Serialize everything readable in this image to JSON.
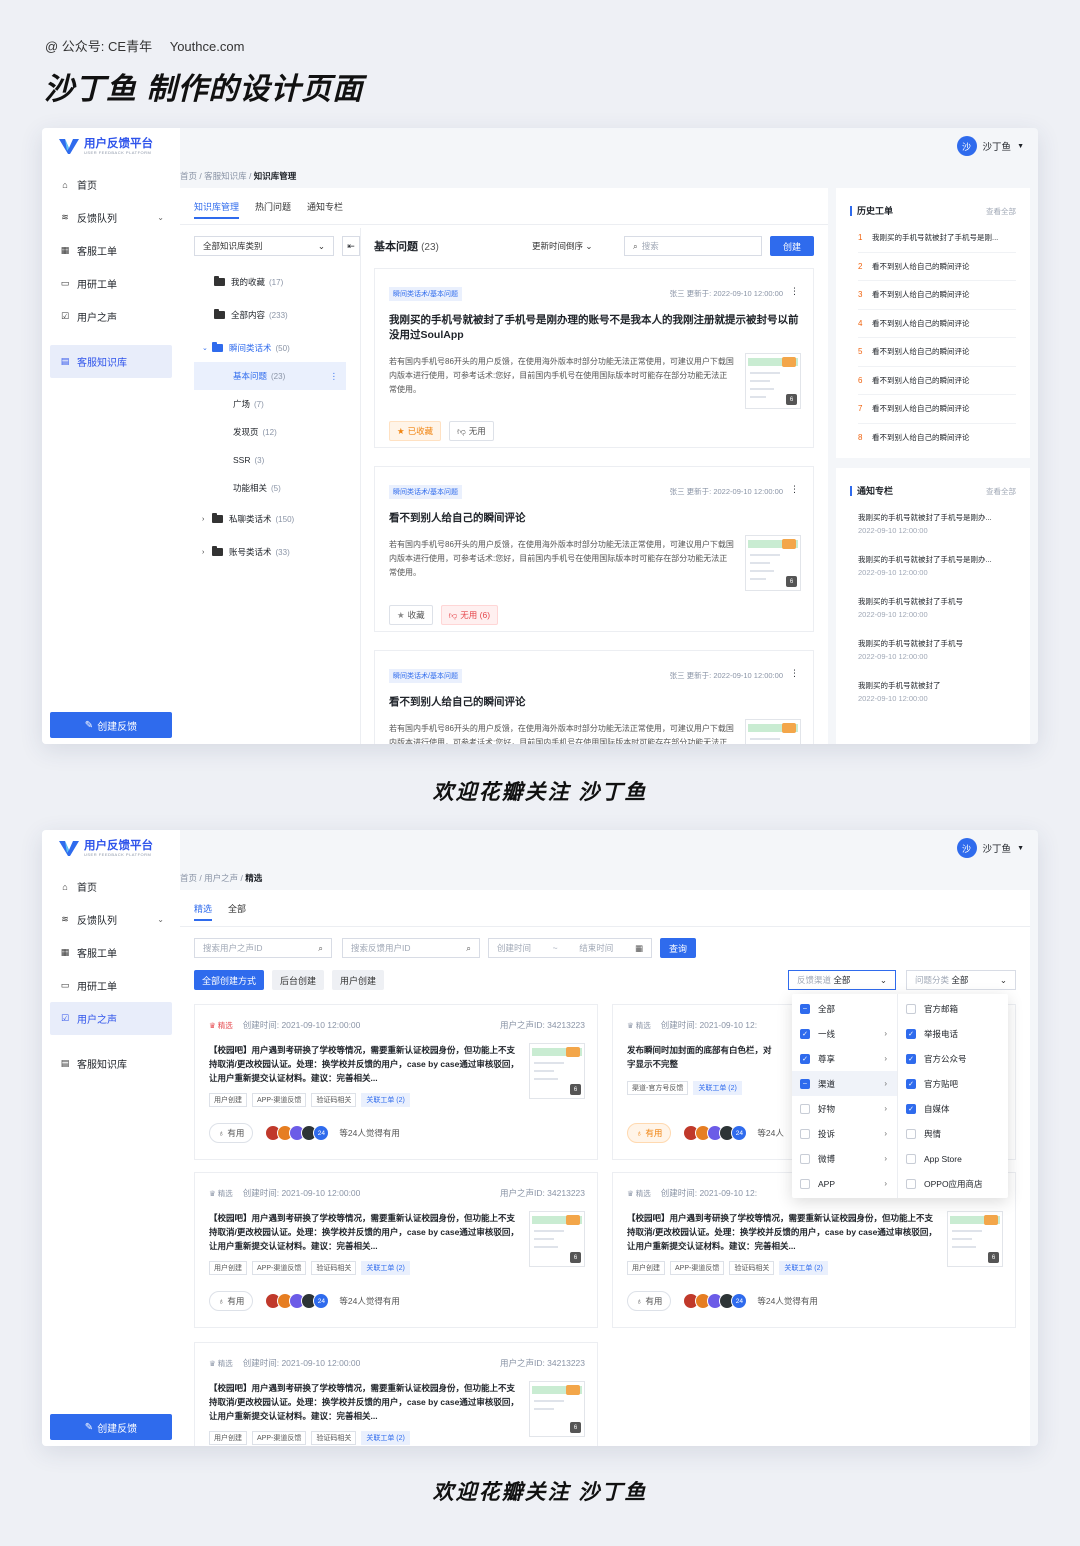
{
  "page": {
    "meta_account": "@ 公众号: CE青年",
    "meta_site": "Youthce.com",
    "heading": "沙丁鱼 制作的设计页面",
    "caption": "欢迎花瓣关注 沙丁鱼"
  },
  "app": {
    "logo_title": "用户反馈平台",
    "logo_sub": "USER FEEDBACK PLATFORM",
    "user_name": "沙丁鱼",
    "user_avatar": "沙",
    "create_button": "创建反馈",
    "nav": [
      {
        "label": "首页",
        "icon": "home-icon"
      },
      {
        "label": "反馈队列",
        "icon": "stack-icon"
      },
      {
        "label": "客服工单",
        "icon": "grid-icon"
      },
      {
        "label": "用研工单",
        "icon": "monitor-icon"
      },
      {
        "label": "用户之声",
        "icon": "chat-icon"
      },
      {
        "label": "客服知识库",
        "icon": "book-icon"
      }
    ]
  },
  "screen1": {
    "breadcrumb": [
      "首页",
      "客服知识库",
      "知识库管理"
    ],
    "tabs": [
      "知识库管理",
      "热门问题",
      "通知专栏"
    ],
    "category_select": "全部知识库类别",
    "tree": [
      {
        "label": "我的收藏",
        "count": "(17)"
      },
      {
        "label": "全部内容",
        "count": "(233)"
      },
      {
        "label": "瞬间类话术",
        "count": "(50)"
      },
      {
        "label": "基本问题",
        "count": "(23)"
      },
      {
        "label": "广场",
        "count": "(7)"
      },
      {
        "label": "发现页",
        "count": "(12)"
      },
      {
        "label": "SSR",
        "count": "(3)"
      },
      {
        "label": "功能相关",
        "count": "(5)"
      },
      {
        "label": "私聊类话术",
        "count": "(150)"
      },
      {
        "label": "账号类话术",
        "count": "(33)"
      }
    ],
    "list_title": "基本问题",
    "list_count": "(23)",
    "sort_label": "更新时间倒序",
    "search_placeholder": "搜索",
    "create_label": "创建",
    "cards": [
      {
        "tag": "瞬间类话术/基本问题",
        "meta": "张三 更新于: 2022-09-10 12:00:00",
        "title": "我刚买的手机号就被封了手机号是刚办理的账号不是我本人的我刚注册就提示被封号以前没用过SoulApp",
        "body": "若有国内手机号86开头的用户反馈，在使用海外版本时部分功能无法正常使用，可建议用户下载国内版本进行使用，可参考话术:您好，目前国内手机号在使用国际版本时可能存在部分功能无法正常使用。",
        "thumb_count": "6",
        "fav_label": "已收藏",
        "useless_label": "无用"
      },
      {
        "tag": "瞬间类话术/基本问题",
        "meta": "张三 更新于: 2022-09-10 12:00:00",
        "title": "看不到别人给自己的瞬间评论",
        "body": "若有国内手机号86开头的用户反馈，在使用海外版本时部分功能无法正常使用，可建议用户下载国内版本进行使用，可参考话术:您好，目前国内手机号在使用国际版本时可能存在部分功能无法正常使用。",
        "thumb_count": "6",
        "fav_label": "收藏",
        "useless_label": "无用 (6)"
      },
      {
        "tag": "瞬间类话术/基本问题",
        "meta": "张三 更新于: 2022-09-10 12:00:00",
        "title": "看不到别人给自己的瞬间评论",
        "body": "若有国内手机号86开头的用户反馈，在使用海外版本时部分功能无法正常使用，可建议用户下载国内版本进行使用，可参考话术:您好，目前国内手机号在使用国际版本时可能存在部分功能无法正常使用。",
        "thumb_count": "6"
      }
    ],
    "history": {
      "title": "历史工单",
      "more": "查看全部",
      "items": [
        {
          "num": "1",
          "text": "我刚买的手机号就被封了手机号是刚..."
        },
        {
          "num": "2",
          "text": "看不到别人给自己的瞬间评论"
        },
        {
          "num": "3",
          "text": "看不到别人给自己的瞬间评论"
        },
        {
          "num": "4",
          "text": "看不到别人给自己的瞬间评论"
        },
        {
          "num": "5",
          "text": "看不到别人给自己的瞬间评论"
        },
        {
          "num": "6",
          "text": "看不到别人给自己的瞬间评论"
        },
        {
          "num": "7",
          "text": "看不到别人给自己的瞬间评论"
        },
        {
          "num": "8",
          "text": "看不到别人给自己的瞬间评论"
        }
      ]
    },
    "notice": {
      "title": "通知专栏",
      "more": "查看全部",
      "items": [
        {
          "title": "我刚买的手机号就被封了手机号是刚办...",
          "date": "2022-09-10 12:00:00"
        },
        {
          "title": "我刚买的手机号就被封了手机号是刚办...",
          "date": "2022-09-10 12:00:00"
        },
        {
          "title": "我刚买的手机号就被封了手机号",
          "date": "2022-09-10 12:00:00"
        },
        {
          "title": "我刚买的手机号就被封了手机号",
          "date": "2022-09-10 12:00:00"
        },
        {
          "title": "我刚买的手机号就被封了",
          "date": "2022-09-10 12:00:00"
        }
      ]
    }
  },
  "screen2": {
    "breadcrumb": [
      "首页",
      "用户之声",
      "精选"
    ],
    "tabs": [
      "精选",
      "全部"
    ],
    "search_voice_placeholder": "搜索用户之声ID",
    "search_user_placeholder": "搜索反馈用户ID",
    "start_time": "创建时间",
    "end_time": "结束时间",
    "time_sep": "~",
    "query_label": "查询",
    "create_modes": [
      "全部创建方式",
      "后台创建",
      "用户创建"
    ],
    "channel_filter": {
      "label": "反馈渠道",
      "value": "全部"
    },
    "category_filter": {
      "label": "问题分类",
      "value": "全部"
    },
    "cards": [
      {
        "featured": "精选",
        "created": "创建时间: 2021-09-10 12:00:00",
        "voice_id": "用户之声ID: 34213223",
        "text": "【校园吧】用户遇到考研换了学校等情况，需要重新认证校园身份，但功能上不支持取消/更改校园认证。处理：换学校并反馈的用户，case by case通过审核驳回，让用户重新提交认证材料。建议：完善相关...",
        "tags": [
          "用户创建",
          "APP-渠道反馈",
          "验证码相关"
        ],
        "link_tag": "关联工单 (2)",
        "useful": "有用",
        "avatar_count": "24",
        "agree": "等24人觉得有用",
        "thumb_count": "6"
      },
      {
        "featured": "精选",
        "created": "创建时间: 2021-09-10 12:",
        "voice_id": "",
        "text": "发布瞬间时加封面的底部有白色栏，对字显示不完整",
        "tags": [
          "渠道-官方号反馈"
        ],
        "link_tag": "关联工单 (2)",
        "useful": "有用",
        "avatar_count": "24",
        "agree": "等24人",
        "thumb_count": ""
      },
      {
        "featured": "精选",
        "created": "创建时间: 2021-09-10 12:00:00",
        "voice_id": "用户之声ID: 34213223",
        "text": "【校园吧】用户遇到考研换了学校等情况，需要重新认证校园身份，但功能上不支持取消/更改校园认证。处理：换学校并反馈的用户，case by case通过审核驳回，让用户重新提交认证材料。建议：完善相关...",
        "tags": [
          "用户创建",
          "APP-渠道反馈",
          "验证码相关"
        ],
        "link_tag": "关联工单 (2)",
        "useful": "有用",
        "avatar_count": "24",
        "agree": "等24人觉得有用",
        "thumb_count": "6"
      },
      {
        "featured": "精选",
        "created": "创建时间: 2021-09-10 12:",
        "voice_id": "",
        "text": "【校园吧】用户遇到考研换了学校等情况，需要重新认证校园身份，但功能上不支持取消/更改校园认证。处理：换学校并反馈的用户，case by case通过审核驳回，让用户重新提交认证材料。建议：完善相关...",
        "tags": [
          "用户创建",
          "APP-渠道反馈",
          "验证码相关"
        ],
        "link_tag": "关联工单 (2)",
        "useful": "有用",
        "avatar_count": "24",
        "agree": "等24人觉得有用",
        "thumb_count": "6"
      },
      {
        "featured": "精选",
        "created": "创建时间: 2021-09-10 12:00:00",
        "voice_id": "用户之声ID: 34213223",
        "text": "【校园吧】用户遇到考研换了学校等情况，需要重新认证校园身份，但功能上不支持取消/更改校园认证。处理：换学校并反馈的用户，case by case通过审核驳回，让用户重新提交认证材料。建议：完善相关...",
        "tags": [
          "用户创建",
          "APP-渠道反馈",
          "验证码相关"
        ],
        "link_tag": "关联工单 (2)",
        "thumb_count": "6"
      }
    ],
    "dropdown_left": [
      {
        "label": "全部",
        "state": "half",
        "sub": false
      },
      {
        "label": "一线",
        "state": "on",
        "sub": true
      },
      {
        "label": "尊享",
        "state": "on",
        "sub": true
      },
      {
        "label": "渠道",
        "state": "half",
        "sub": true
      },
      {
        "label": "好物",
        "state": "off",
        "sub": true
      },
      {
        "label": "投诉",
        "state": "off",
        "sub": true
      },
      {
        "label": "微博",
        "state": "off",
        "sub": true
      },
      {
        "label": "APP",
        "state": "off",
        "sub": true
      }
    ],
    "dropdown_right": [
      {
        "label": "官方邮箱",
        "state": "off"
      },
      {
        "label": "举报电话",
        "state": "on"
      },
      {
        "label": "官方公众号",
        "state": "on"
      },
      {
        "label": "官方贴吧",
        "state": "on"
      },
      {
        "label": "自媒体",
        "state": "on"
      },
      {
        "label": "舆情",
        "state": "off"
      },
      {
        "label": "App Store",
        "state": "off"
      },
      {
        "label": "OPPO应用商店",
        "state": "off"
      }
    ]
  }
}
